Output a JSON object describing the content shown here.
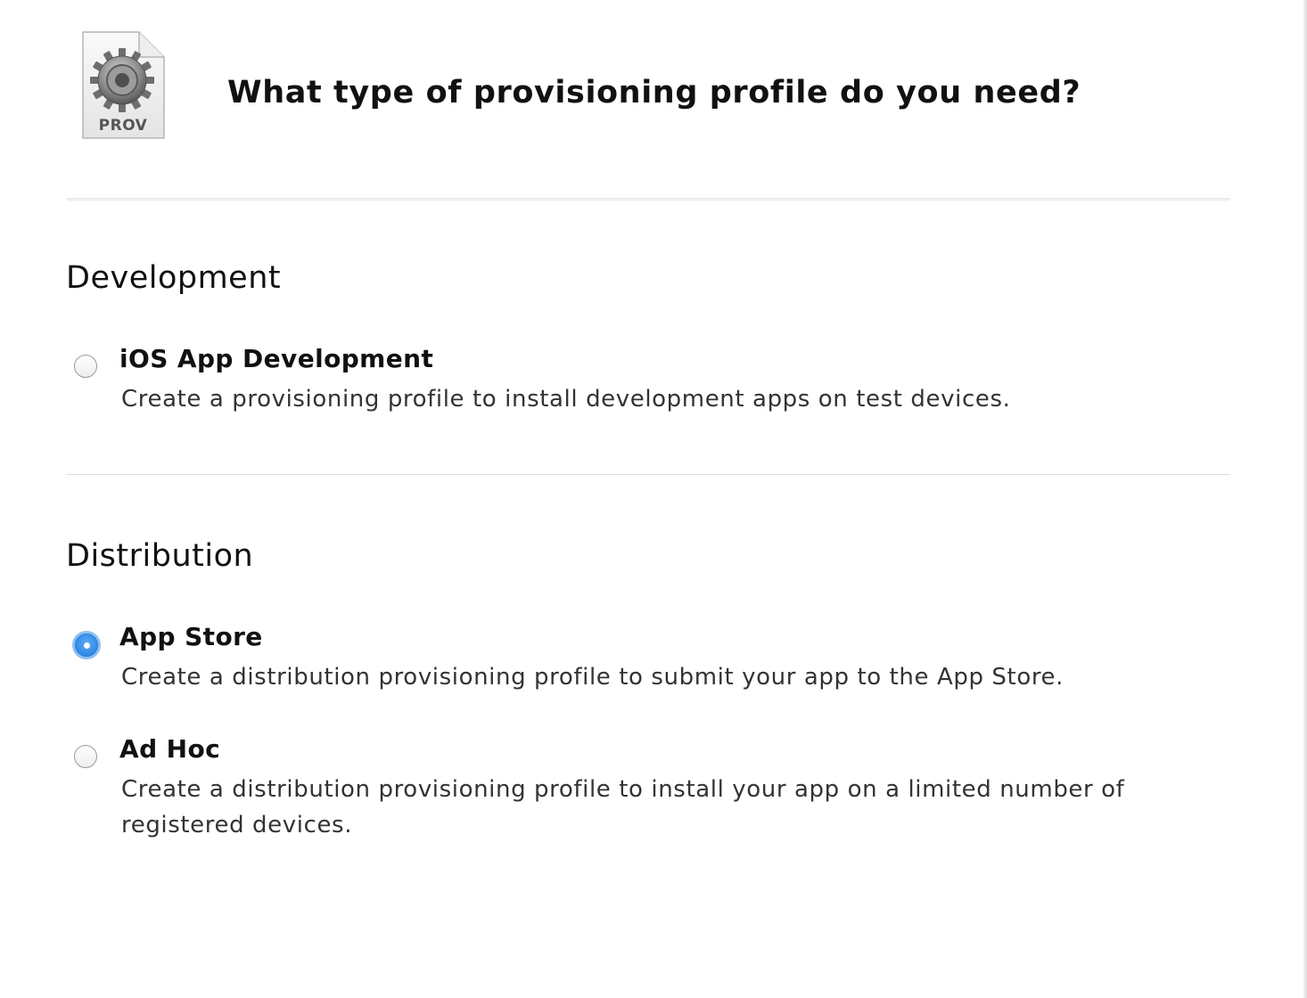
{
  "header": {
    "icon": "prov-gear-document-icon",
    "icon_label": "PROV",
    "title": "What type of provisioning profile do you need?"
  },
  "sections": [
    {
      "heading": "Development",
      "options": [
        {
          "title": "iOS App Development",
          "description": "Create a provisioning profile to install development apps on test devices.",
          "selected": false
        }
      ]
    },
    {
      "heading": "Distribution",
      "options": [
        {
          "title": "App Store",
          "description": "Create a distribution provisioning profile to submit your app to the App Store.",
          "selected": true
        },
        {
          "title": "Ad Hoc",
          "description": "Create a distribution provisioning profile to install your app on a limited number of registered devices.",
          "selected": false
        }
      ]
    }
  ],
  "colors": {
    "selected_radio": "#1f7ae0",
    "divider": "#dcdcdc"
  }
}
